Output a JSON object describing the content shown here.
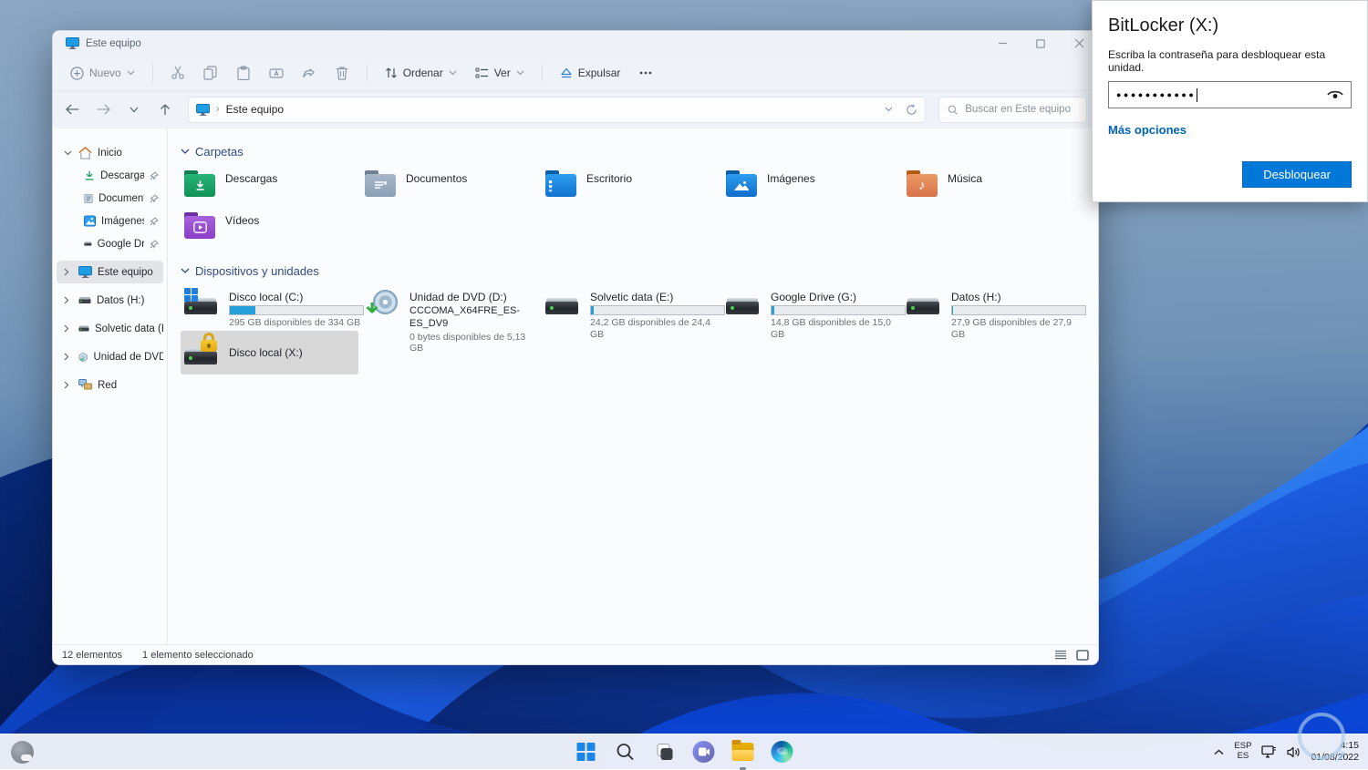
{
  "window": {
    "title": "Este equipo"
  },
  "toolbar": {
    "new_label": "Nuevo",
    "sort_label": "Ordenar",
    "view_label": "Ver",
    "eject_label": "Expulsar",
    "more_label": "..."
  },
  "addressbar": {
    "breadcrumb": "Este equipo",
    "breadcrumb_separator": "›",
    "search_placeholder": "Buscar en Este equipo"
  },
  "sidebar": {
    "items": [
      {
        "label": "Inicio"
      },
      {
        "label": "Descargas"
      },
      {
        "label": "Documentos"
      },
      {
        "label": "Imágenes"
      },
      {
        "label": "Google Drive (G"
      },
      {
        "label": "Este equipo"
      },
      {
        "label": "Datos (H:)"
      },
      {
        "label": "Solvetic data (E:)"
      },
      {
        "label": "Unidad de DVD (D:)"
      },
      {
        "label": "Red"
      }
    ]
  },
  "sections": {
    "folders": {
      "header": "Carpetas",
      "items": [
        {
          "name": "Descargas"
        },
        {
          "name": "Documentos"
        },
        {
          "name": "Escritorio"
        },
        {
          "name": "Imágenes"
        },
        {
          "name": "Música"
        },
        {
          "name": "Vídeos"
        }
      ]
    },
    "devices": {
      "header": "Dispositivos y unidades",
      "items": [
        {
          "name": "Disco local (C:)",
          "caption": "295 GB disponibles de 334 GB",
          "bar_pct": "19%"
        },
        {
          "name": "Unidad de DVD (D:)",
          "subtitle": "CCCOMA_X64FRE_ES-ES_DV9",
          "caption": "0 bytes disponibles de 5,13 GB"
        },
        {
          "name": "Solvetic data (E:)",
          "caption": "24,2 GB disponibles de 24,4 GB",
          "bar_pct": "2%"
        },
        {
          "name": "Google Drive (G:)",
          "caption": "14,8 GB disponibles de 15,0 GB",
          "bar_pct": "2%"
        },
        {
          "name": "Datos (H:)",
          "caption": "27,9 GB disponibles de 27,9 GB",
          "bar_pct": "1%"
        },
        {
          "name": "Disco local (X:)"
        }
      ]
    }
  },
  "statusbar": {
    "items_count": "12 elementos",
    "selected_count": "1 elemento seleccionado"
  },
  "bitlocker": {
    "title": "BitLocker (X:)",
    "prompt": "Escriba la contraseña para desbloquear esta unidad.",
    "password_masked": "●●●●●●●●●●●",
    "more_options_label": "Más opciones",
    "unlock_label": "Desbloquear",
    "accent_color": "#0078d7"
  },
  "taskbar": {
    "tray": {
      "language_line1": "ESP",
      "language_line2": "ES",
      "time": "4:15",
      "date": "01/08/2022"
    }
  }
}
